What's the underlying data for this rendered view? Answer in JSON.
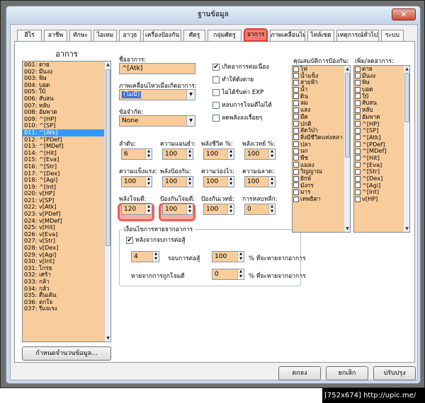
{
  "window": {
    "title": "ฐานข้อมูล",
    "close_symbol": "✕"
  },
  "tabs": [
    "ฮีโร่",
    "อาชีพ",
    "ทักษะ",
    "ไอเทม",
    "อาวุธ",
    "เครื่องป้องกัน",
    "ศัตรู",
    "กลุ่มศัตรู",
    "อาการ",
    "ภาพเคลื่อนไหว",
    "ไทล์เซต",
    "เหตุการณ์ทั่วไป",
    "ระบบ"
  ],
  "active_tab": "อาการ",
  "left": {
    "header": "อาการ",
    "items": [
      "001: ตาย",
      "002: มึนงง",
      "003: พิษ",
      "004: บอด",
      "005: ใบ้",
      "006: สับสน",
      "007: หลับ",
      "008: อัมพาต",
      "009: ^[HP]",
      "010: ^[SP]",
      "011: ^[Atk]",
      "012: ^[PDef]",
      "013: ^[MDef]",
      "014: ^[Hit]",
      "015: ^[Eva]",
      "016: ^[Str]",
      "017: ^[Dex]",
      "018: ^[Agi]",
      "019: ^[Int]",
      "020: v[HP]",
      "021: v[SP]",
      "022: v[Atk]",
      "023: v[PDef]",
      "024: v[MDef]",
      "025: v[Hit]",
      "026: v[Eva]",
      "027: v[Str]",
      "028: v[Dex]",
      "029: v[Agi]",
      "030: v[Int]",
      "031: โกรธ",
      "032: เศร้า",
      "033: กล้า",
      "034: กลัว",
      "035: ตื่นเต้น",
      "036: ตกใจ",
      "037: รีแจเรง"
    ],
    "selected_index": 10,
    "max_button": "กำหนดจำนวนข้อมูล..."
  },
  "form": {
    "name_label": "ชื่ออาการ:",
    "name_value": "^[Atk]",
    "anim_label": "ภาพเคลื่อนไหวเมื่อเกิดอาการ:",
    "anim_value": "(ไม่มี)",
    "restriction_label": "ข้อจำกัด:",
    "restriction_value": "None",
    "checks": [
      {
        "label": "เกิดอาการต่อเนื่อง",
        "checked": true
      },
      {
        "label": "ทำให้ดังตาย",
        "checked": false
      },
      {
        "label": "ไม่ได้รับค่า EXP",
        "checked": false
      },
      {
        "label": "หลบการโจมตีไม่ได้",
        "checked": false
      },
      {
        "label": "ลดพลังลงเรื่อยๆ",
        "checked": false
      }
    ],
    "row1_labels": [
      "ลำดับ:",
      "ความแม่นยำ:",
      "พลังชีวิต %:",
      "พลังเวทย์ %:"
    ],
    "row1_values": [
      "6",
      "100",
      "100",
      "100"
    ],
    "row2_labels": [
      "ความแข็งแรง:",
      "พลังป้องกัน:",
      "ความว่องไว:",
      "ความฉลาด:"
    ],
    "row2_values": [
      "100",
      "100",
      "100",
      "100"
    ],
    "row3_labels": [
      "พลังโจมตี:",
      "ป้องกันโจมตี:",
      "ป้องกันเวทย์:",
      "การหลบหลีก:"
    ],
    "row3_values": [
      "120",
      "100",
      "100",
      "0"
    ],
    "release": {
      "legend": "เงื่อนไขการหายจากอาการ",
      "after_battle_label": "หลังจากจบการต่อสู้",
      "after_battle_checked": true,
      "turns_value": "4",
      "turns_label": "รอบการต่อสู้",
      "turns_pct_value": "100",
      "pct_label": "% ที่จะหายจากอาการ",
      "damage_label": "หายจากการถูกโจมตี",
      "damage_pct_value": "0"
    }
  },
  "guard": {
    "label": "คุณสมบัติการป้องกัน:",
    "items": [
      "ไฟ",
      "น้ำแข็ง",
      "สายฟ้า",
      "น้ำ",
      "ดิน",
      "ลม",
      "แสง",
      "มืด",
      "ปกติ",
      "สัตว์ป่า",
      "สิ่งมีชีวิตแห่งหลา",
      "ปลา",
      "นก",
      "พืช",
      "แมลง",
      "วิญญาณ",
      "ยักษ์",
      "มังกร",
      "มาร",
      "เทพธิดา"
    ]
  },
  "plusminus": {
    "label": "เพิ่ม/ลดอาการ:",
    "items": [
      "ตาย",
      "มึนงง",
      "พิษ",
      "บอด",
      "ใบ้",
      "สับสน",
      "หลับ",
      "อัมพาต",
      "^[HP]",
      "^[SP]",
      "^[Atk]",
      "^[PDef]",
      "^[MDef]",
      "^[Hit]",
      "^[Eva]",
      "^[Str]",
      "^[Dex]",
      "^[Agi]",
      "^[Int]",
      "v[HP]"
    ]
  },
  "buttons": {
    "ok": "ตกลง",
    "cancel": "ยกเลิก",
    "apply": "ปรับปรุง"
  },
  "footer": "[752x674] http://upic.me/",
  "colors": {
    "field": "#f8cd9b",
    "tab_active": "#f77a70",
    "highlight": "#ef5e55",
    "selection": "#3399ff"
  }
}
